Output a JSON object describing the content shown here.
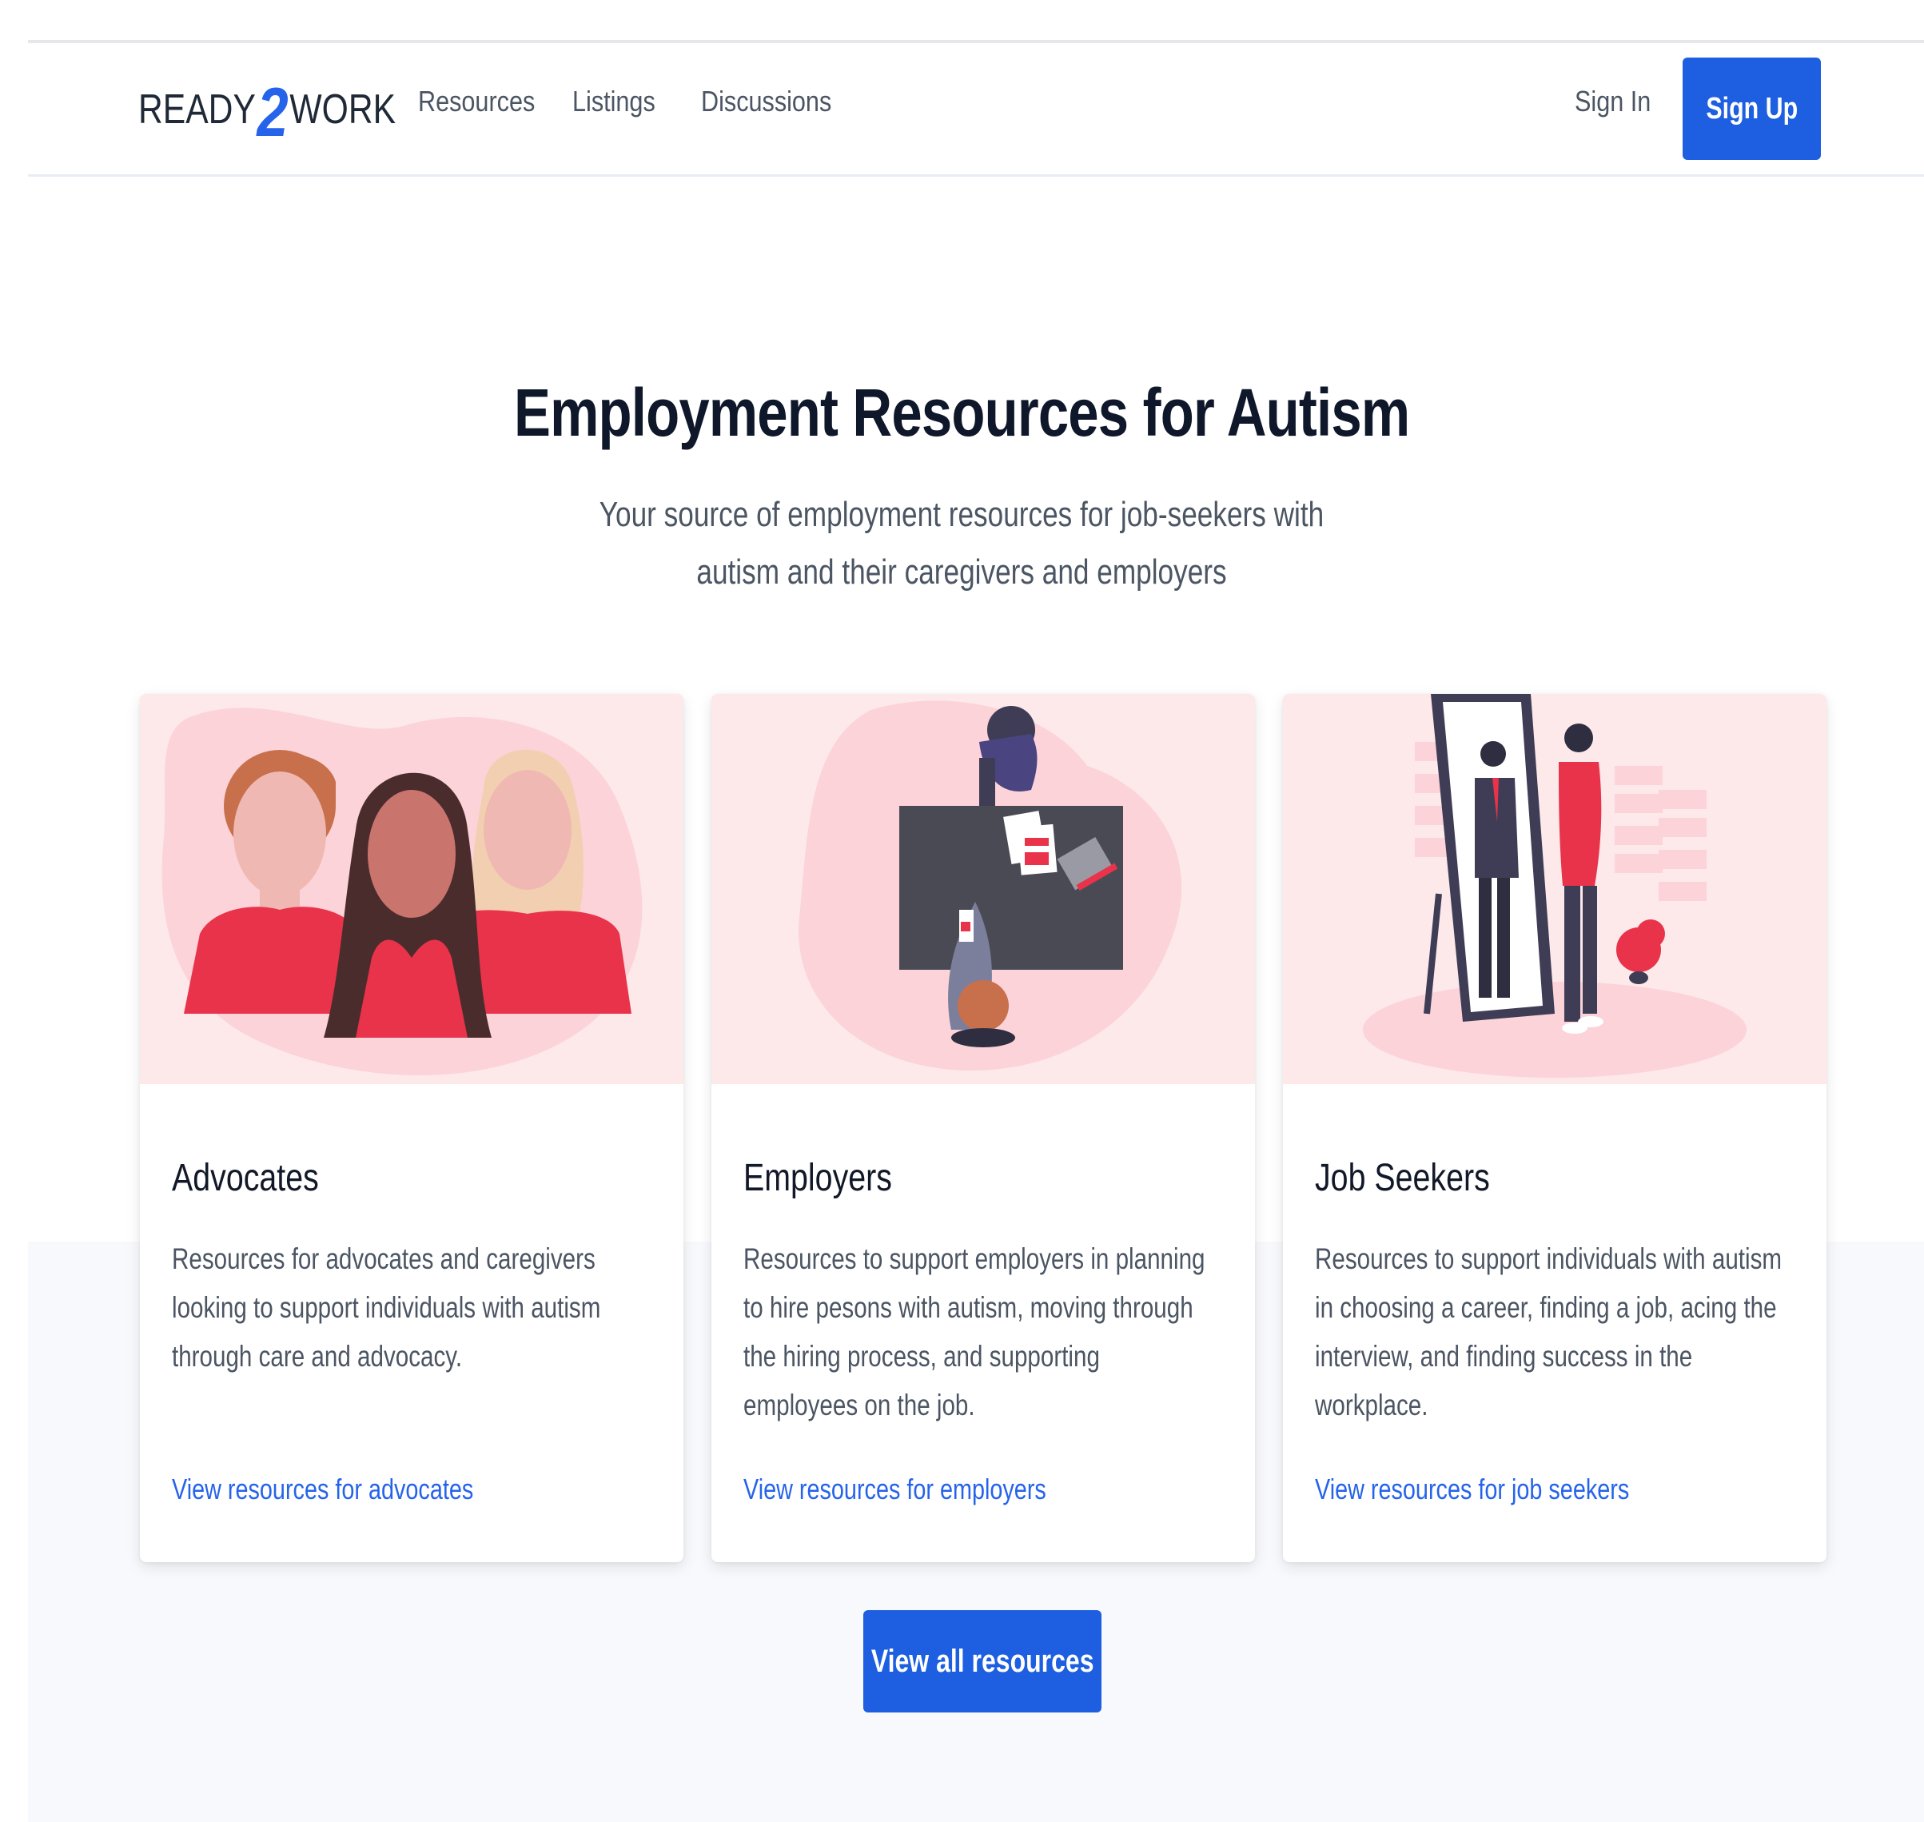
{
  "nav": {
    "logo_left": "READY",
    "logo_mid": "2",
    "logo_right": "WORK",
    "links": [
      "Resources",
      "Listings",
      "Discussions"
    ],
    "sign_in": "Sign In",
    "sign_up": "Sign Up"
  },
  "hero": {
    "title": "Employment Resources for Autism",
    "subtitle": "Your source of employment resources for job-seekers with autism and their caregivers and employers"
  },
  "cards": [
    {
      "title": "Advocates",
      "description": "Resources for advocates and caregivers looking to support individuals with autism through care and advocacy.",
      "link": "View resources for advocates"
    },
    {
      "title": "Employers",
      "description": "Resources to support employers in planning to hire pesons with autism, moving through the hiring process, and supporting employees on the job.",
      "link": "View resources for employers"
    },
    {
      "title": "Job Seekers",
      "description": "Resources to support individuals with autism in choosing a career, finding a job, acing the interview, and finding success in the workplace.",
      "link": "View resources for job seekers"
    }
  ],
  "cta": {
    "view_all": "View all resources"
  },
  "colors": {
    "accent": "#1d5fe0",
    "link": "#2563eb",
    "illustration_bg": "#fde8ea",
    "illustration_red": "#e8334a"
  }
}
